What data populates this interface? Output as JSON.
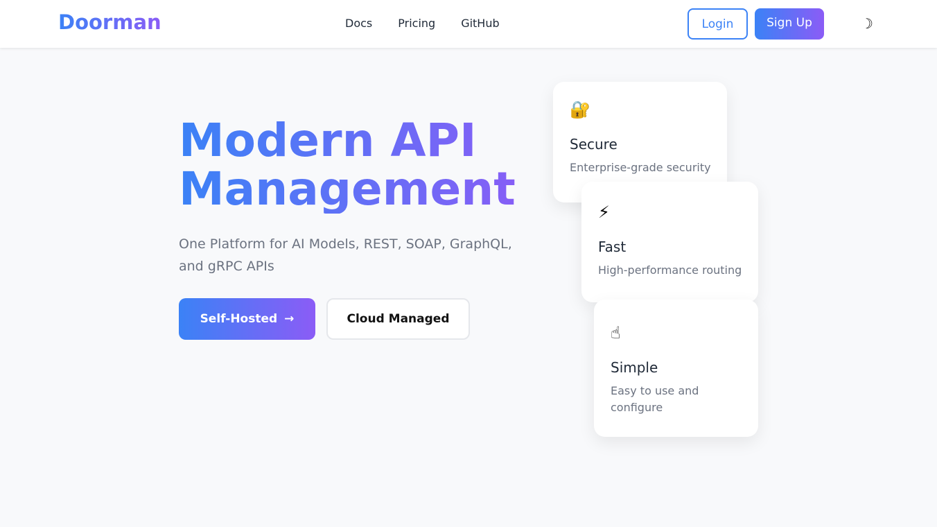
{
  "nav": {
    "logo": "Doorman",
    "links": [
      "Docs",
      "Pricing",
      "GitHub"
    ],
    "login": "Login",
    "signup": "Sign Up",
    "theme_icon": "moon-icon"
  },
  "hero": {
    "title_line1": "Modern API",
    "title_line2": "Management",
    "subtitle": "One Platform for AI Models, REST, SOAP, GraphQL, and gRPC APIs",
    "primary_button": "Self-Hosted",
    "primary_arrow": "→",
    "secondary_button": "Cloud Managed"
  },
  "features": [
    {
      "icon": "🔐",
      "title": "Secure",
      "desc": "Enterprise-grade security"
    },
    {
      "icon": "⚡",
      "title": "Fast",
      "desc": "High-performance routing"
    },
    {
      "icon": "☝",
      "title": "Simple",
      "desc": "Easy to use and configure"
    }
  ]
}
